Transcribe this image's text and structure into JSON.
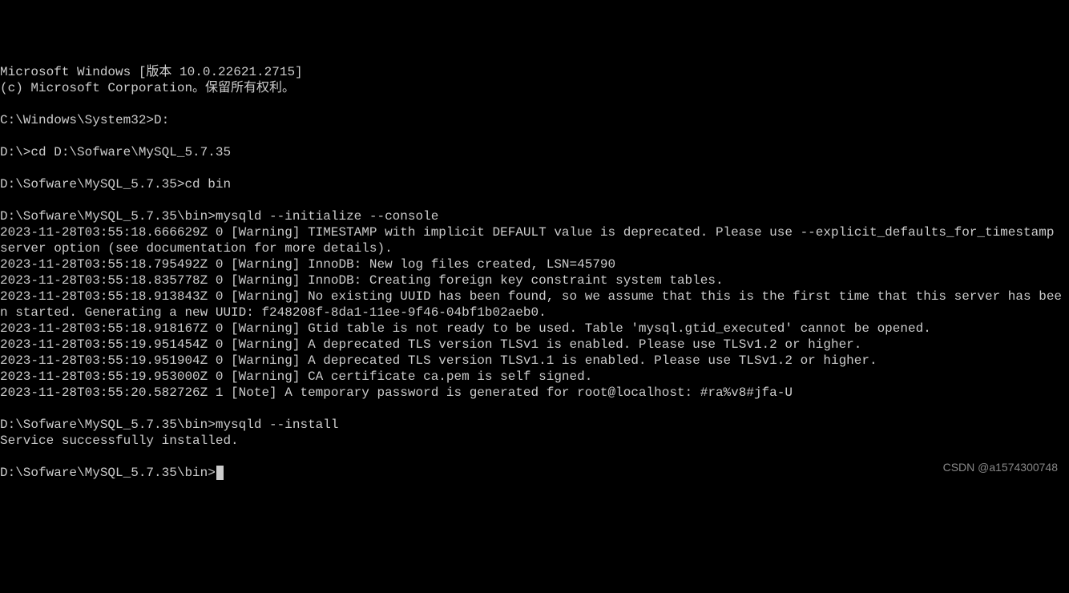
{
  "header": {
    "line1": "Microsoft Windows [版本 10.0.22621.2715]",
    "line2": "(c) Microsoft Corporation。保留所有权利。"
  },
  "commands": [
    {
      "prompt": "C:\\Windows\\System32>",
      "cmd": "D:"
    },
    {
      "prompt": "D:\\>",
      "cmd": "cd D:\\Sofware\\MySQL_5.7.35"
    },
    {
      "prompt": "D:\\Sofware\\MySQL_5.7.35>",
      "cmd": "cd bin"
    },
    {
      "prompt": "D:\\Sofware\\MySQL_5.7.35\\bin>",
      "cmd": "mysqld --initialize --console"
    }
  ],
  "output": [
    "2023-11-28T03:55:18.666629Z 0 [Warning] TIMESTAMP with implicit DEFAULT value is deprecated. Please use --explicit_defaults_for_timestamp server option (see documentation for more details).",
    "2023-11-28T03:55:18.795492Z 0 [Warning] InnoDB: New log files created, LSN=45790",
    "2023-11-28T03:55:18.835778Z 0 [Warning] InnoDB: Creating foreign key constraint system tables.",
    "2023-11-28T03:55:18.913843Z 0 [Warning] No existing UUID has been found, so we assume that this is the first time that this server has been started. Generating a new UUID: f248208f-8da1-11ee-9f46-04bf1b02aeb0.",
    "2023-11-28T03:55:18.918167Z 0 [Warning] Gtid table is not ready to be used. Table 'mysql.gtid_executed' cannot be opened.",
    "2023-11-28T03:55:19.951454Z 0 [Warning] A deprecated TLS version TLSv1 is enabled. Please use TLSv1.2 or higher.",
    "2023-11-28T03:55:19.951904Z 0 [Warning] A deprecated TLS version TLSv1.1 is enabled. Please use TLSv1.2 or higher.",
    "2023-11-28T03:55:19.953000Z 0 [Warning] CA certificate ca.pem is self signed.",
    "2023-11-28T03:55:20.582726Z 1 [Note] A temporary password is generated for root@localhost: #ra%v8#jfa-U"
  ],
  "install": {
    "prompt": "D:\\Sofware\\MySQL_5.7.35\\bin>",
    "cmd": "mysqld --install",
    "result": "Service successfully installed."
  },
  "final_prompt": "D:\\Sofware\\MySQL_5.7.35\\bin>",
  "watermark": "CSDN @a1574300748"
}
